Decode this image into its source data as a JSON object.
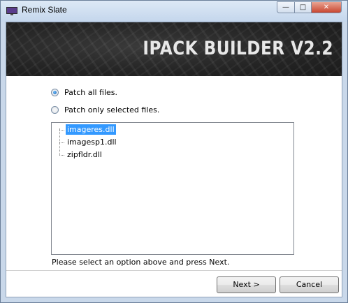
{
  "window": {
    "title": "Remix Slate",
    "controls": {
      "minimize": "—",
      "maximize": "□",
      "close": "✕"
    }
  },
  "banner": {
    "title": "IPACK BUILDER V2.2"
  },
  "options": [
    {
      "label": "Patch all files.",
      "checked": true
    },
    {
      "label": "Patch only selected files.",
      "checked": false
    }
  ],
  "files": [
    {
      "name": "imageres.dll",
      "selected": true
    },
    {
      "name": "imagesp1.dll",
      "selected": false
    },
    {
      "name": "zipfldr.dll",
      "selected": false
    }
  ],
  "status": "Please select an option above and press Next.",
  "buttons": {
    "next": "Next >",
    "cancel": "Cancel"
  },
  "colors": {
    "selection": "#3399ff",
    "banner_bg": "#242424",
    "frame": "#c9d8ea"
  }
}
